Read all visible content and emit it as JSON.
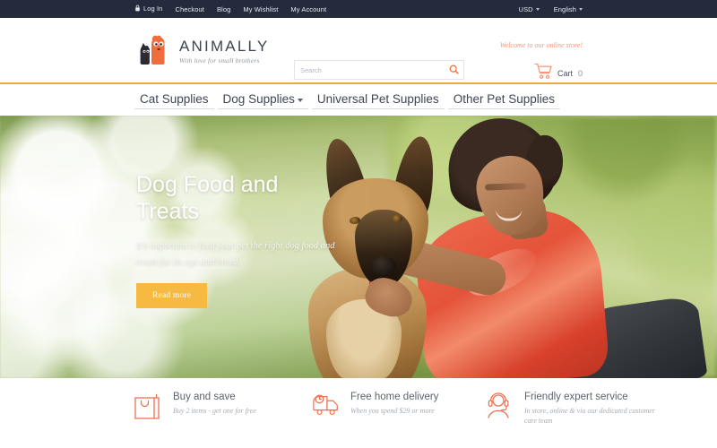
{
  "topbar": {
    "lock_icon": "lock-icon",
    "links": [
      {
        "label": "Log In"
      },
      {
        "label": "Checkout"
      },
      {
        "label": "Blog"
      },
      {
        "label": "My Wishlist"
      },
      {
        "label": "My Account"
      }
    ],
    "currency": {
      "label": "USD",
      "icon": "chevron-down-icon"
    },
    "language": {
      "label": "English",
      "icon": "chevron-down-icon"
    },
    "background": "#242b3d"
  },
  "header": {
    "logo": {
      "name": "ANIMALLY",
      "tagline": "With love for small brothers",
      "icon": "cat-and-dog-logo-icon"
    },
    "search": {
      "placeholder": "Search",
      "value": "",
      "icon": "search-icon"
    },
    "welcome_message": "Welcome to our online store!",
    "cart": {
      "icon": "shopping-cart-icon",
      "label": "Cart",
      "count": "0"
    }
  },
  "nav": {
    "accent_border": "#f0a93c",
    "items": [
      {
        "label": "Cat Supplies",
        "has_dropdown": false
      },
      {
        "label": "Dog Supplies",
        "has_dropdown": true,
        "icon": "chevron-down-icon"
      },
      {
        "label": "Universal Pet Supplies",
        "has_dropdown": false
      },
      {
        "label": "Other Pet Supplies",
        "has_dropdown": false
      }
    ]
  },
  "hero": {
    "title": "Dog Food and Treats",
    "description": "It's important to feed your pet the right dog food and treats for its age and breed.",
    "button_label": "Read more",
    "button_color": "#f6b942",
    "image_alt": "Woman in coral shirt hugging a German Shepherd dog outdoors"
  },
  "features": [
    {
      "icon": "shopping-bag-icon",
      "title": "Buy and save",
      "subtitle": "Buy 2 items - get one for free"
    },
    {
      "icon": "delivery-truck-icon",
      "title": "Free home delivery",
      "subtitle": "When you spend $29 or more"
    },
    {
      "icon": "headset-support-icon",
      "title": "Friendly expert service",
      "subtitle": "In store, online & via our dedicated customer care team"
    }
  ],
  "colors": {
    "accent_orange": "#ef7153",
    "accent_amber": "#f0a93c",
    "dark_navy": "#242b3d",
    "text_grey": "#5c6270"
  }
}
